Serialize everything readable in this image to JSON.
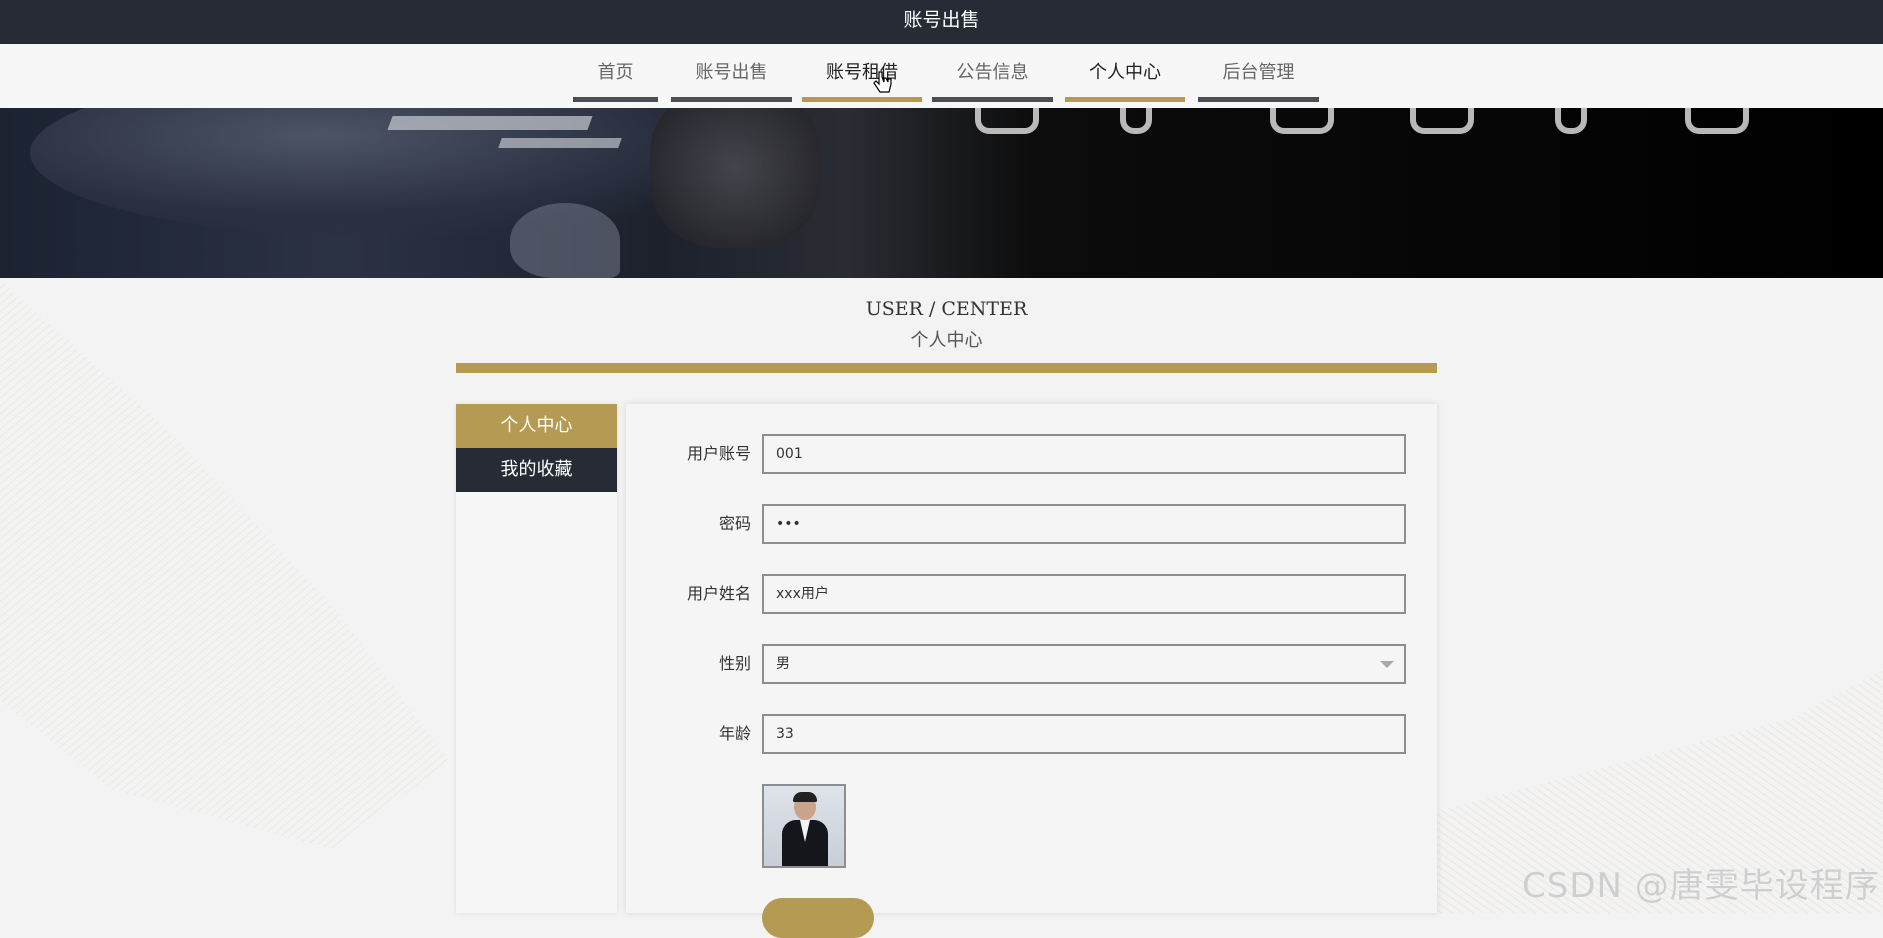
{
  "header": {
    "title": "账号出售"
  },
  "nav": {
    "items": [
      {
        "label": "首页"
      },
      {
        "label": "账号出售"
      },
      {
        "label": "账号租借"
      },
      {
        "label": "公告信息"
      },
      {
        "label": "个人中心"
      },
      {
        "label": "后台管理"
      }
    ]
  },
  "section": {
    "title_en": "USER / CENTER",
    "title_zh": "个人中心"
  },
  "sidebar": {
    "items": [
      {
        "label": "个人中心"
      },
      {
        "label": "我的收藏"
      }
    ]
  },
  "form": {
    "fields": [
      {
        "label": "用户账号",
        "value": "001"
      },
      {
        "label": "密码",
        "value": "•••"
      },
      {
        "label": "用户姓名",
        "value": "xxx用户"
      },
      {
        "label": "性别",
        "value": "男"
      },
      {
        "label": "年龄",
        "value": "33"
      }
    ]
  },
  "watermark": "CSDN @唐雯毕设程序",
  "colors": {
    "accent": "#b49a52",
    "dark": "#262b36",
    "nav_underline": "#4b4d52"
  }
}
